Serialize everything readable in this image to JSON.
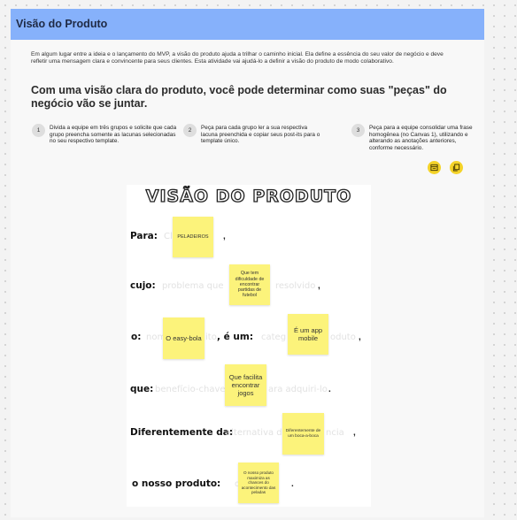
{
  "header": {
    "title": "Visão do Produto"
  },
  "intro": "Em algum lugar entre a ideia e o lançamento do MVP, a visão do produto ajuda a trilhar o caminho inicial. Ela define a essência do seu valor de negócio e deve refletir uma mensagem clara e convincente para seus clientes. Esta atividade vai ajudá-lo a definir a visão do produto de modo colaborativo.",
  "subheading": "Com uma visão clara do produto, você pode determinar como suas \"peças\" do negócio vão se juntar.",
  "steps": [
    {
      "num": "1",
      "text": "Divida a equipe em três grupos e solicite que cada grupo preencha somente as lacunas selecionadas no seu respectivo template."
    },
    {
      "num": "2",
      "text": "Peça para cada grupo ler a sua respectiva lacuna preenchida e copiar seus post-its para o template único."
    },
    {
      "num": "3",
      "text": "Peça para a equipe consolidar uma frase homogênea (no Canvas 1), utilizando e alterando as anotações anteriores, conforme necessário."
    }
  ],
  "tool_icons": [
    "template-icon",
    "copy-icon"
  ],
  "board": {
    "title": "VISÃO DO PRODUTO",
    "labels": {
      "para": "Para:",
      "cujo": "cujo:",
      "o": "o:",
      "e_um": ", é um:",
      "que": "que:",
      "diferentemente": "Diferentemente da:",
      "nosso_produto": "o nosso produto:"
    },
    "ghost": {
      "para": "Cl",
      "cujo_left": "problema que",
      "cujo_right": "resolvido",
      "o_left": "nom",
      "o_mid": "ito",
      "e_um_left": "categ",
      "e_um_right": "oduto",
      "que_left": "benefício-chave",
      "que_right": "ara adquiri-lo",
      "diferentemente_left": "alternativa d",
      "diferentemente_right": "ncia",
      "nosso_left": "difere"
    },
    "stickies": {
      "peladeiros": "PELADEIROS",
      "dificuldade": "Que tem dificuldade de encontrar partidas de futebol",
      "easy_bola": "O easy-bola",
      "app_mobile": "É um app mobile",
      "facilita": "Que facilita encontrar jogos",
      "bocaaboca": "Diferentemente de um boca-a-boca",
      "maximiza": "O nosso produto maximiza as chances do acontecimento das peladas"
    }
  },
  "colors": {
    "header": "#86b1fb",
    "sticky": "#fcf37b",
    "icon": "#f4d329"
  }
}
